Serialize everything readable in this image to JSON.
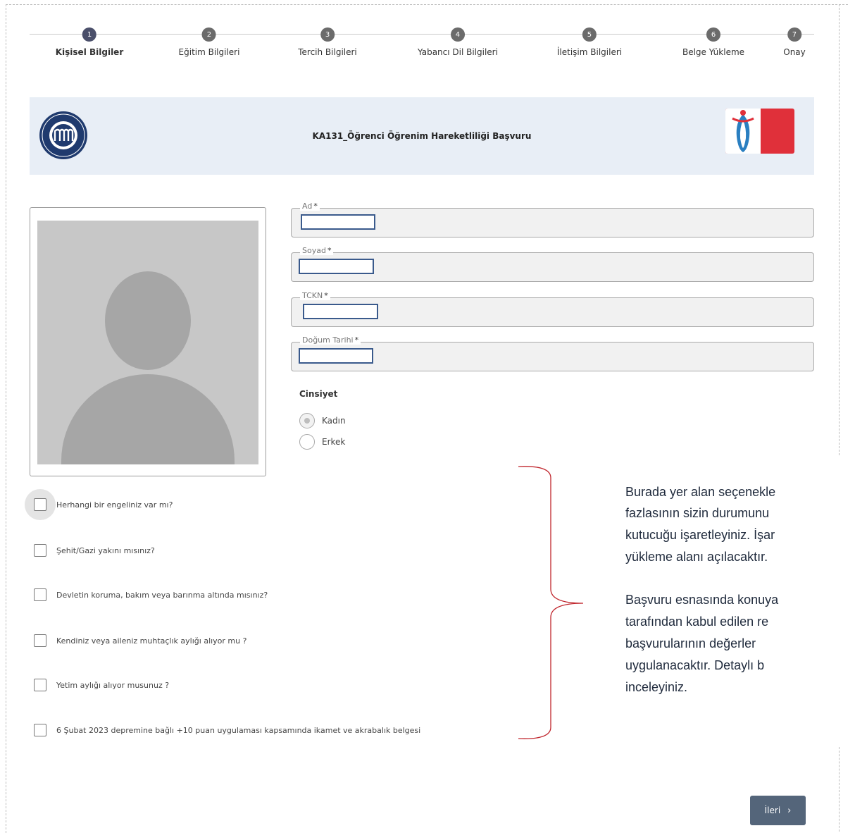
{
  "stepper": {
    "steps": [
      {
        "num": "1",
        "label": "Kişisel Bilgiler"
      },
      {
        "num": "2",
        "label": "Eğitim Bilgileri"
      },
      {
        "num": "3",
        "label": "Tercih Bilgileri"
      },
      {
        "num": "4",
        "label": "Yabancı Dil Bilgileri"
      },
      {
        "num": "5",
        "label": "İletişim Bilgileri"
      },
      {
        "num": "6",
        "label": "Belge Yükleme"
      },
      {
        "num": "7",
        "label": "Onay"
      }
    ],
    "active_step": 1
  },
  "banner": {
    "title": "KA131_Öğrenci Öğrenim Hareketliliği Başvuru"
  },
  "form": {
    "fields": [
      {
        "label": "Ad",
        "required": "*",
        "value": ""
      },
      {
        "label": "Soyad",
        "required": "*",
        "value": ""
      },
      {
        "label": "TCKN",
        "required": "*",
        "value": ""
      },
      {
        "label": "Doğum Tarihi",
        "required": "*",
        "value": ""
      }
    ],
    "gender": {
      "title": "Cinsiyet",
      "options": [
        "Kadın",
        "Erkek"
      ],
      "selected": "Kadın"
    }
  },
  "checkboxes": [
    "Herhangi bir engeliniz var mı?",
    "Şehit/Gazi yakını mısınız?",
    "Devletin koruma, bakım veya barınma altında mısınız?",
    "Kendiniz veya aileniz muhtaçlık aylığı alıyor mu ?",
    "Yetim aylığı alıyor musunuz ?",
    "6 Şubat 2023 depremine bağlı +10 puan uygulaması kapsamında ikamet ve akrabalık belgesi"
  ],
  "annotation": {
    "lines_1": [
      "Burada yer alan seçenekle",
      "fazlasının sizin durumunu",
      "kutucuğu işaretleyiniz. İşar",
      "yükleme alanı açılacaktır."
    ],
    "lines_2": [
      "Başvuru esnasında konuya",
      "tarafından kabul edilen re",
      "başvurularının değerler",
      "uygulanacaktır. Detaylı b",
      "inceleyiniz."
    ],
    "color": "#1f2a3c"
  },
  "actions": {
    "next_label": "İleri",
    "next_icon": "chevron-right-icon"
  },
  "colors": {
    "banner_bg": "#e8eef6",
    "button_bg": "#54657a",
    "bracket": "#c0262d",
    "input_focus": "#3a5a8c"
  }
}
